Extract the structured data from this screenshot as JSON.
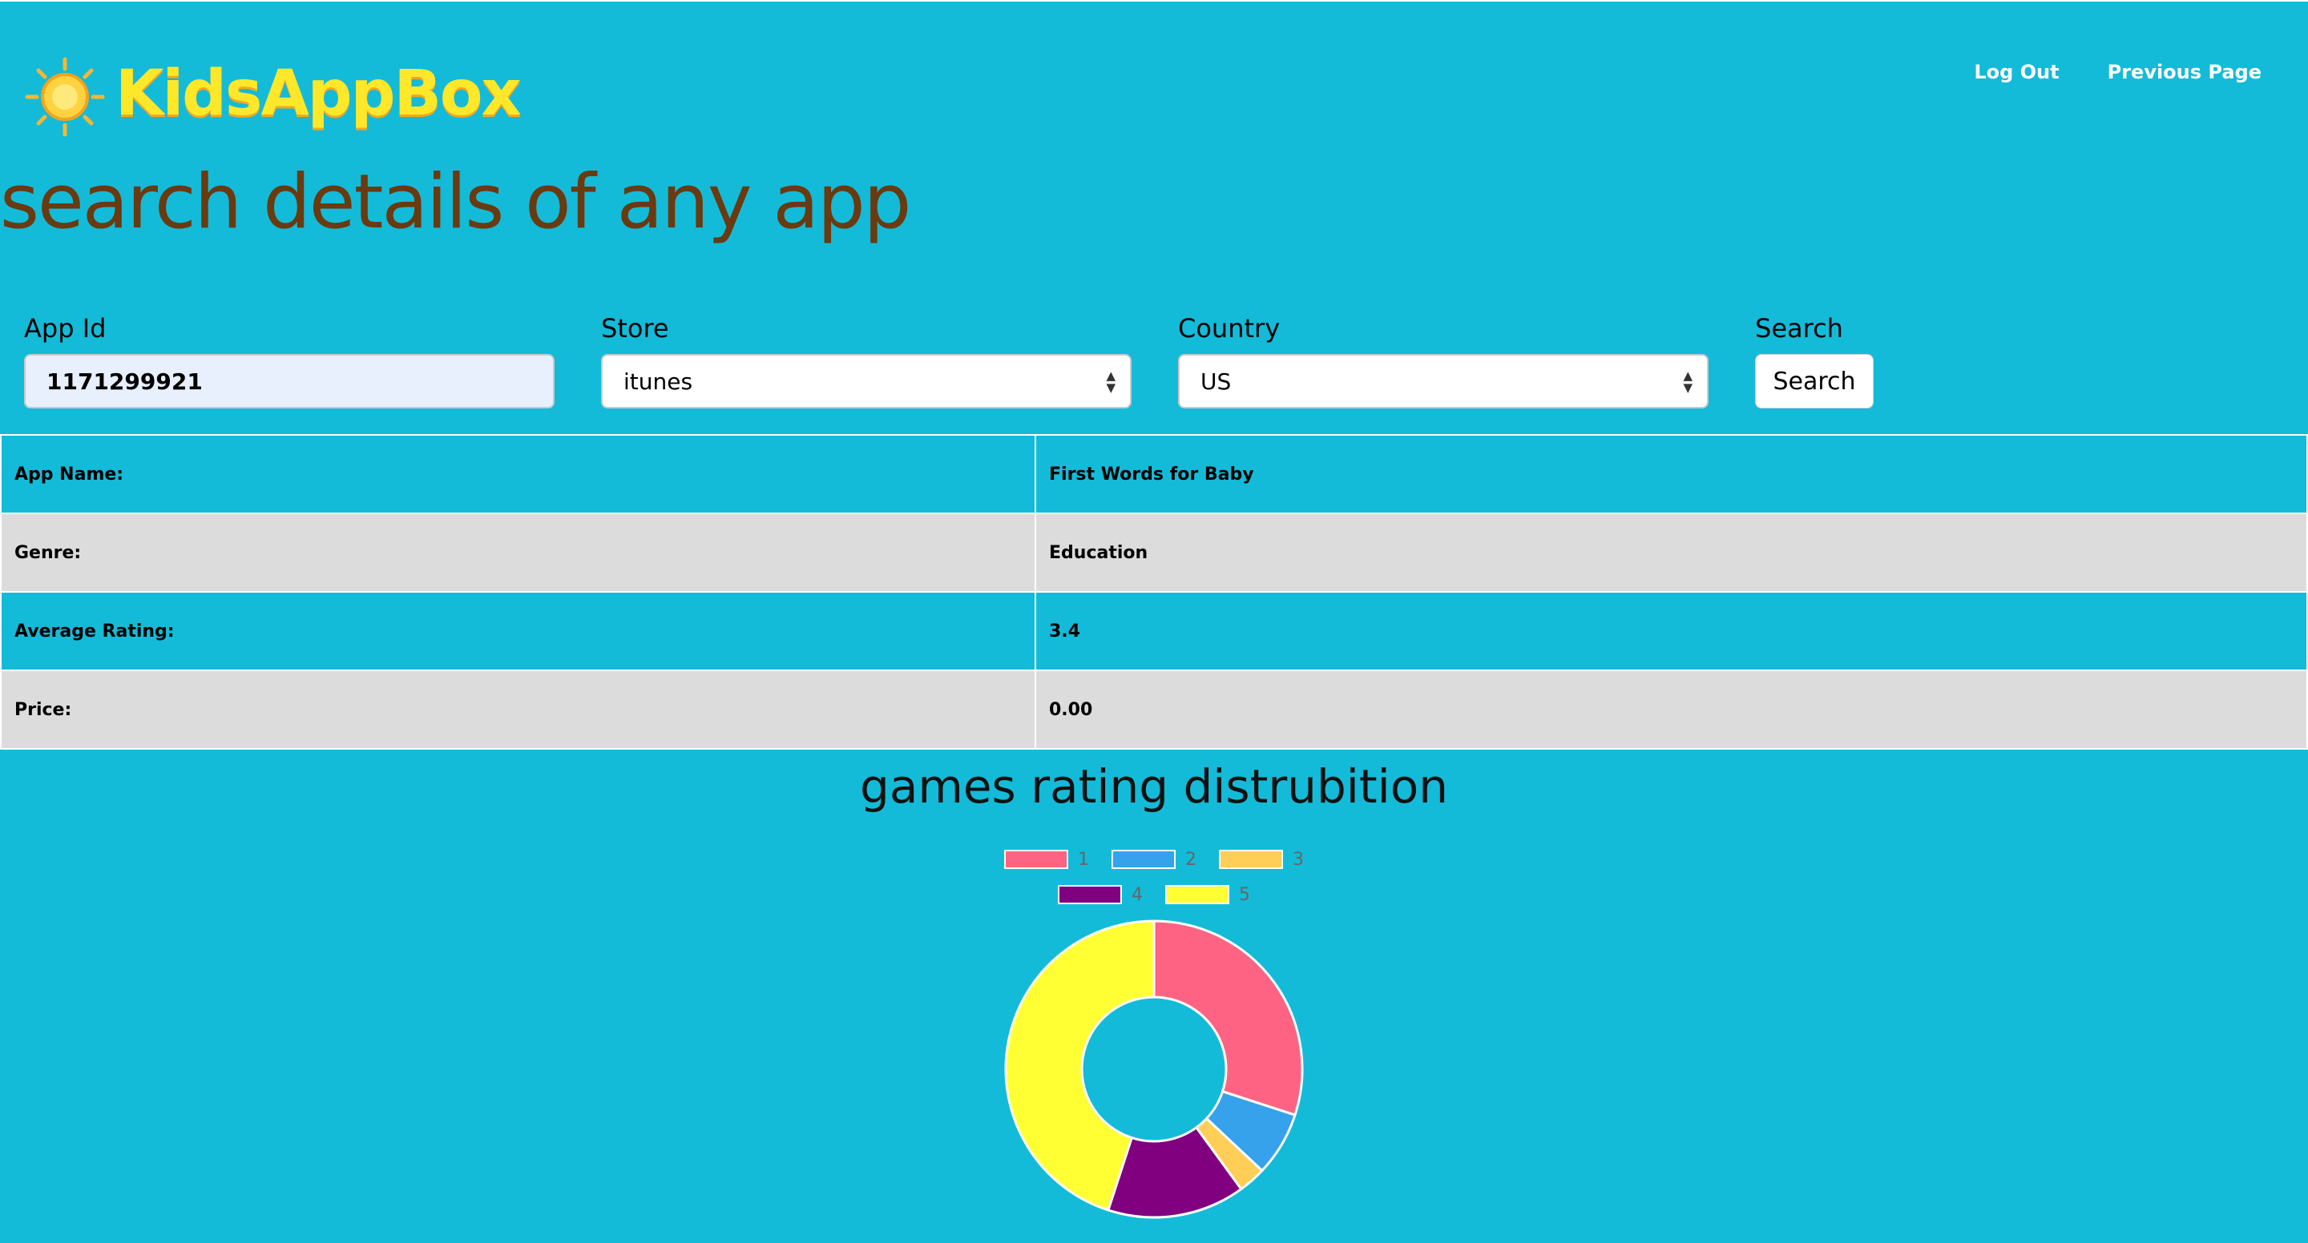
{
  "brand": {
    "name": "KidsAppBox"
  },
  "nav": {
    "logout": "Log Out",
    "previous": "Previous Page"
  },
  "page": {
    "title": "search details of any app"
  },
  "form": {
    "app_id_label": "App Id",
    "app_id_value": "1171299921",
    "store_label": "Store",
    "store_value": "itunes",
    "country_label": "Country",
    "country_value": "US",
    "search_label": "Search",
    "search_button": "Search"
  },
  "details": [
    {
      "label": "App Name:",
      "value": "First Words for Baby"
    },
    {
      "label": "Genre:",
      "value": "Education"
    },
    {
      "label": "Average Rating:",
      "value": "3.4"
    },
    {
      "label": "Price:",
      "value": "0.00"
    }
  ],
  "chart_data": {
    "type": "pie",
    "title": "games rating distrubition",
    "categories": [
      "1",
      "2",
      "3",
      "4",
      "5"
    ],
    "values": [
      30,
      7,
      3,
      15,
      45
    ],
    "colors": [
      "#ff6384",
      "#36a2eb",
      "#ffce56",
      "#800080",
      "#ffff33"
    ],
    "legend_position": "top"
  }
}
